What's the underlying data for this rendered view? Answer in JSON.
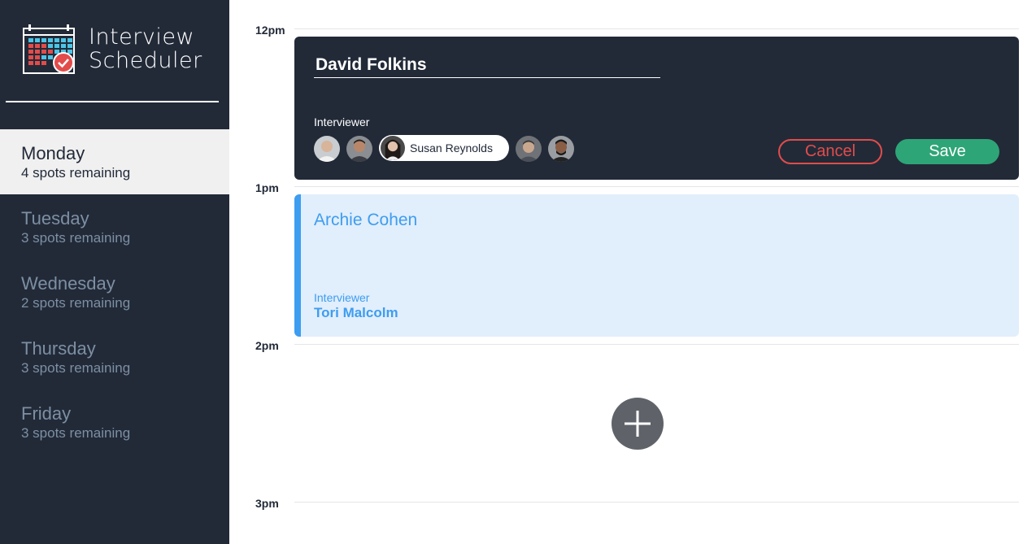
{
  "app": {
    "title_line1": "Interview",
    "title_line2": "Scheduler"
  },
  "days": [
    {
      "name": "Monday",
      "spots": "4 spots remaining",
      "selected": true
    },
    {
      "name": "Tuesday",
      "spots": "3 spots remaining",
      "selected": false
    },
    {
      "name": "Wednesday",
      "spots": "2 spots remaining",
      "selected": false
    },
    {
      "name": "Thursday",
      "spots": "3 spots remaining",
      "selected": false
    },
    {
      "name": "Friday",
      "spots": "3 spots remaining",
      "selected": false
    }
  ],
  "schedule": {
    "times": [
      "12pm",
      "1pm",
      "2pm",
      "3pm"
    ]
  },
  "form": {
    "student_name": "David Folkins",
    "interviewer_label": "Interviewer",
    "selected_interviewer": "Susan Reynolds",
    "cancel_label": "Cancel",
    "save_label": "Save"
  },
  "appointment": {
    "student": "Archie Cohen",
    "interviewer_label": "Interviewer",
    "interviewer_name": "Tori Malcolm"
  },
  "colors": {
    "sidebar_bg": "#222a38",
    "accent_blue": "#3d9df0",
    "save_green": "#2ea577",
    "cancel_red": "#e24c4b",
    "add_button": "#5f6369"
  },
  "icons": {
    "logo": "calendar-check-icon",
    "add": "plus-icon"
  }
}
